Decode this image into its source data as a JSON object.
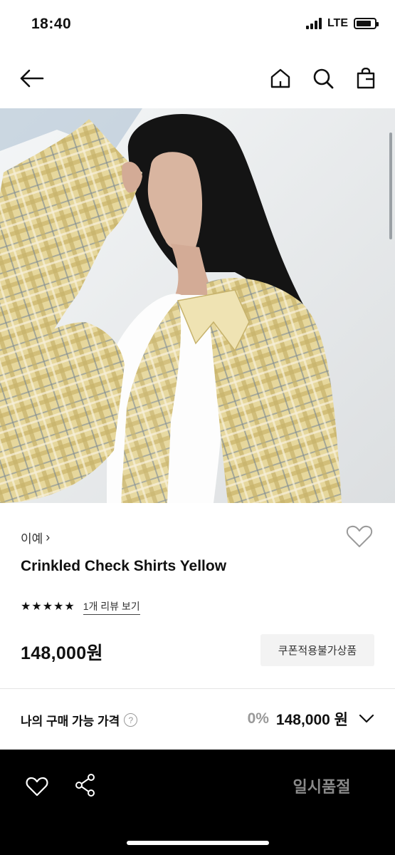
{
  "status_bar": {
    "time": "18:40",
    "network": "LTE",
    "battery_level": 0.85,
    "signal_bars": 4
  },
  "nav": {
    "back_icon": "arrow-left-icon",
    "home_icon": "home-icon",
    "search_icon": "search-icon",
    "cart_icon": "shopping-bag-icon"
  },
  "product": {
    "brand": "이예",
    "brand_chevron": "›",
    "name": "Crinkled Check Shirts Yellow",
    "rating_stars": 5,
    "review_link": "1개 리뷰 보기",
    "price": "148,000원",
    "coupon_label": "쿠폰적용불가상품",
    "wishlist_icon": "heart-outline-icon"
  },
  "my_price": {
    "label": "나의 구매 가능 가격",
    "help_icon_text": "?",
    "discount": "0%",
    "price": "148,000 원"
  },
  "bottom_bar": {
    "wish_icon": "heart-outline-icon",
    "share_icon": "share-icon",
    "soldout_label": "일시품절"
  },
  "colors": {
    "bottom_bar_bg": "#000000",
    "soldout_text": "#8a8a8a",
    "coupon_bg": "#f3f3f3"
  }
}
